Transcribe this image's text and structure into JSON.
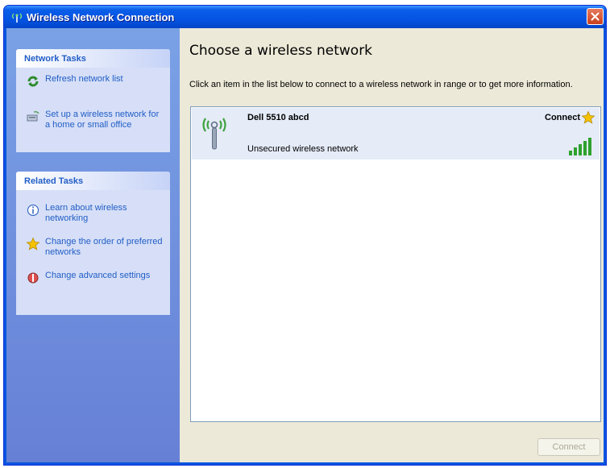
{
  "window": {
    "title": "Wireless Network Connection",
    "close_icon": "close-icon",
    "title_icon": "wireless-icon"
  },
  "sidebar": {
    "network_tasks": {
      "header": "Network Tasks",
      "items": [
        {
          "label": "Refresh network list",
          "icon": "refresh-icon"
        },
        {
          "label": "Set up a wireless network for a home or small office",
          "icon": "setup-network-icon"
        }
      ]
    },
    "related_tasks": {
      "header": "Related Tasks",
      "items": [
        {
          "label": "Learn about wireless networking",
          "icon": "info-icon"
        },
        {
          "label": "Change the order of preferred networks",
          "icon": "star-icon"
        },
        {
          "label": "Change advanced settings",
          "icon": "settings-icon"
        }
      ]
    }
  },
  "main": {
    "title": "Choose a wireless network",
    "description": "Click an item in the list below to connect to a wireless network in range or to get more information."
  },
  "networks": [
    {
      "name": "Dell 5510 abcd",
      "status": "Connect",
      "security": "Unsecured wireless network",
      "signal_bars": 5,
      "signal_max": 5
    }
  ],
  "footer": {
    "connect_label": "Connect"
  },
  "colors": {
    "accent": "#215dc6",
    "titlebar": "#0554e3",
    "signal": "#2fa12f",
    "star": "#f6c200"
  }
}
